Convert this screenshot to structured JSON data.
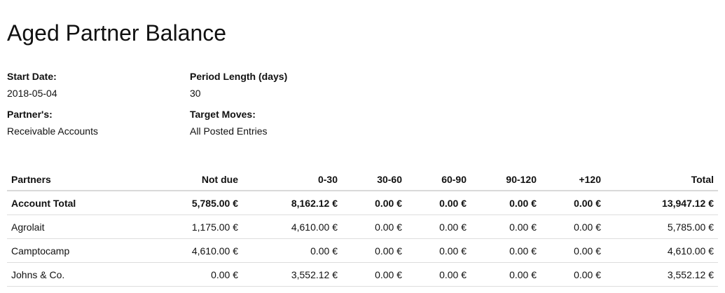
{
  "report": {
    "title": "Aged Partner Balance",
    "filters": {
      "start_date_label": "Start Date:",
      "start_date_value": "2018-05-04",
      "period_length_label": "Period Length (days)",
      "period_length_value": "30",
      "partners_label": "Partner's:",
      "partners_value": "Receivable Accounts",
      "target_moves_label": "Target Moves:",
      "target_moves_value": "All Posted Entries"
    },
    "table": {
      "headers": [
        "Partners",
        "Not due",
        "0-30",
        "30-60",
        "60-90",
        "90-120",
        "+120",
        "Total"
      ],
      "total_row": [
        "Account Total",
        "5,785.00 €",
        "8,162.12 €",
        "0.00 €",
        "0.00 €",
        "0.00 €",
        "0.00 €",
        "13,947.12 €"
      ],
      "rows": [
        [
          "Agrolait",
          "1,175.00 €",
          "4,610.00 €",
          "0.00 €",
          "0.00 €",
          "0.00 €",
          "0.00 €",
          "5,785.00 €"
        ],
        [
          "Camptocamp",
          "4,610.00 €",
          "0.00 €",
          "0.00 €",
          "0.00 €",
          "0.00 €",
          "0.00 €",
          "4,610.00 €"
        ],
        [
          "Johns & Co.",
          "0.00 €",
          "3,552.12 €",
          "0.00 €",
          "0.00 €",
          "0.00 €",
          "0.00 €",
          "3,552.12 €"
        ]
      ]
    }
  }
}
